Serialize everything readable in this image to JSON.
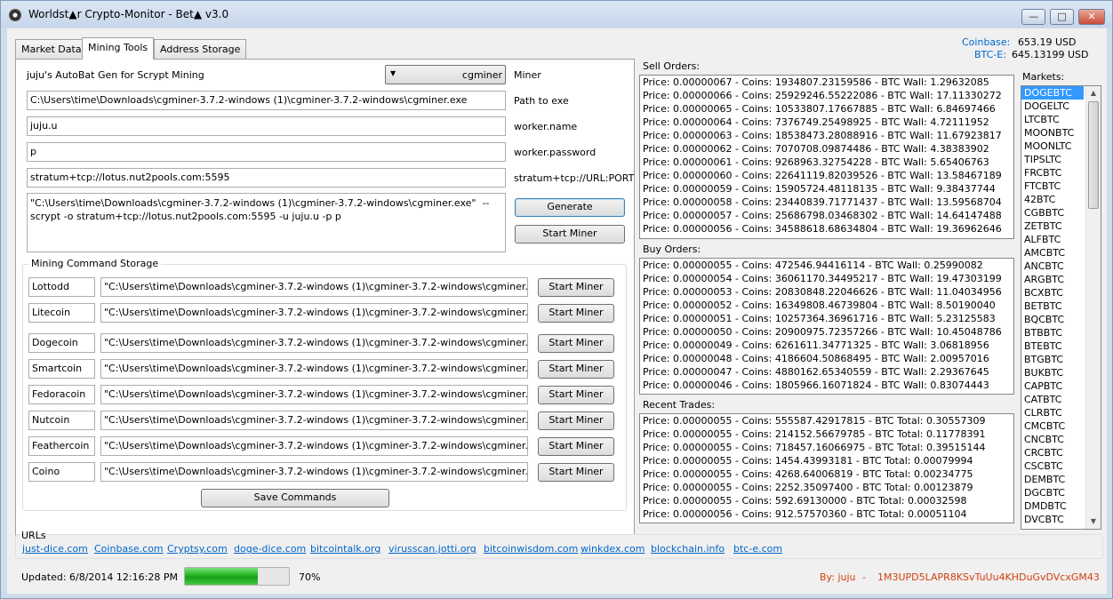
{
  "window": {
    "title": "Worldst▲r Crypto-Monitor - Bet▲ v3.0"
  },
  "tabs": [
    {
      "label": "Market Data"
    },
    {
      "label": "Mining Tools",
      "active": true
    },
    {
      "label": "Address Storage"
    }
  ],
  "autobat": {
    "heading": "juju's AutoBat Gen for Scrypt Mining",
    "miner_select": "cgminer",
    "miner_label": "Miner",
    "path_value": "C:\\Users\\time\\Downloads\\cgminer-3.7.2-windows (1)\\cgminer-3.7.2-windows\\cgminer.exe",
    "path_label": "Path to exe",
    "worker_name_value": "juju.u",
    "worker_name_label": "worker.name",
    "worker_password_value": "p",
    "worker_password_label": "worker.password",
    "url_value": "stratum+tcp://lotus.nut2pools.com:5595",
    "url_label": "stratum+tcp://URL:PORT",
    "command_output": "\"C:\\Users\\time\\Downloads\\cgminer-3.7.2-windows (1)\\cgminer-3.7.2-windows\\cgminer.exe\"  --scrypt -o stratum+tcp://lotus.nut2pools.com:5595 -u juju.u -p p",
    "generate_label": "Generate",
    "start_miner_label": "Start Miner"
  },
  "storage": {
    "title": "Mining Command Storage",
    "rows": [
      {
        "name": "Lottodd",
        "command": "\"C:\\Users\\time\\Downloads\\cgminer-3.7.2-windows (1)\\cgminer-3.7.2-windows\\cgminer.exe\"",
        "button": "Start Miner"
      },
      {
        "name": "Litecoin",
        "command": "\"C:\\Users\\time\\Downloads\\cgminer-3.7.2-windows (1)\\cgminer-3.7.2-windows\\cgminer.exe\"",
        "button": "Start Miner"
      },
      {
        "name": "Dogecoin",
        "command": "\"C:\\Users\\time\\Downloads\\cgminer-3.7.2-windows (1)\\cgminer-3.7.2-windows\\cgminer.exe\"",
        "button": "Start Miner"
      },
      {
        "name": "Smartcoin",
        "command": "\"C:\\Users\\time\\Downloads\\cgminer-3.7.2-windows (1)\\cgminer-3.7.2-windows\\cgminer.exe\"",
        "button": "Start Miner"
      },
      {
        "name": "Fedoracoin",
        "command": "\"C:\\Users\\time\\Downloads\\cgminer-3.7.2-windows (1)\\cgminer-3.7.2-windows\\cgminer.exe\" -",
        "button": "Start Miner"
      },
      {
        "name": "Nutcoin",
        "command": "\"C:\\Users\\time\\Downloads\\cgminer-3.7.2-windows (1)\\cgminer-3.7.2-windows\\cgminer.exe\"",
        "button": "Start Miner"
      },
      {
        "name": "Feathercoin",
        "command": "\"C:\\Users\\time\\Downloads\\cgminer-3.7.2-windows (1)\\cgminer-3.7.2-windows\\cgminer.exe\"",
        "button": "Start Miner"
      },
      {
        "name": "Coino",
        "command": "\"C:\\Users\\time\\Downloads\\cgminer-3.7.2-windows (1)\\cgminer-3.7.2-windows\\cgminer.exe\"",
        "button": "Start Miner"
      }
    ],
    "save_label": "Save Commands"
  },
  "prices": {
    "coinbase_label": "Coinbase:",
    "coinbase_value": "653.19 USD",
    "btce_label": "BTC-E:",
    "btce_value": "645.13199 USD",
    "accent_color": "#0066cc"
  },
  "sell_orders": {
    "title": "Sell Orders:",
    "rows": [
      "Price: 0.00000067 - Coins: 1934807.23159586 - BTC Wall: 1.29632085",
      "Price: 0.00000066 - Coins: 25929246.55222086 - BTC Wall: 17.11330272",
      "Price: 0.00000065 - Coins: 10533807.17667885 - BTC Wall: 6.84697466",
      "Price: 0.00000064 - Coins: 7376749.25498925 - BTC Wall: 4.72111952",
      "Price: 0.00000063 - Coins: 18538473.28088916 - BTC Wall: 11.67923817",
      "Price: 0.00000062 - Coins: 7070708.09874486 - BTC Wall: 4.38383902",
      "Price: 0.00000061 - Coins: 9268963.32754228 - BTC Wall: 5.65406763",
      "Price: 0.00000060 - Coins: 22641119.82039526 - BTC Wall: 13.58467189",
      "Price: 0.00000059 - Coins: 15905724.48118135 - BTC Wall: 9.38437744",
      "Price: 0.00000058 - Coins: 23440839.71771437 - BTC Wall: 13.59568704",
      "Price: 0.00000057 - Coins: 25686798.03468302 - BTC Wall: 14.64147488",
      "Price: 0.00000056 - Coins: 34588618.68634804 - BTC Wall: 19.36962646"
    ]
  },
  "buy_orders": {
    "title": "Buy Orders:",
    "rows": [
      "Price: 0.00000055 - Coins: 472546.94416114 - BTC Wall: 0.25990082",
      "Price: 0.00000054 - Coins: 36061170.34495217 - BTC Wall: 19.47303199",
      "Price: 0.00000053 - Coins: 20830848.22046626 - BTC Wall: 11.04034956",
      "Price: 0.00000052 - Coins: 16349808.46739804 - BTC Wall: 8.50190040",
      "Price: 0.00000051 - Coins: 10257364.36961716 - BTC Wall: 5.23125583",
      "Price: 0.00000050 - Coins: 20900975.72357266 - BTC Wall: 10.45048786",
      "Price: 0.00000049 - Coins: 6261611.34771325 - BTC Wall: 3.06818956",
      "Price: 0.00000048 - Coins: 4186604.50868495 - BTC Wall: 2.00957016",
      "Price: 0.00000047 - Coins: 4880162.65340559 - BTC Wall: 2.29367645",
      "Price: 0.00000046 - Coins: 1805966.16071824 - BTC Wall: 0.83074443"
    ]
  },
  "recent_trades": {
    "title": "Recent Trades:",
    "rows": [
      "Price: 0.00000055 - Coins: 555587.42917815 - BTC Total: 0.30557309",
      "Price: 0.00000055 - Coins: 214152.56679785 - BTC Total: 0.11778391",
      "Price: 0.00000055 - Coins: 718457.16066975 - BTC Total: 0.39515144",
      "Price: 0.00000055 - Coins: 1454.43993181 - BTC Total: 0.00079994",
      "Price: 0.00000055 - Coins: 4268.64006819 - BTC Total: 0.00234775",
      "Price: 0.00000055 - Coins: 2252.35097400 - BTC Total: 0.00123879",
      "Price: 0.00000055 - Coins: 592.69130000 - BTC Total: 0.00032598",
      "Price: 0.00000056 - Coins: 912.57570360 - BTC Total: 0.00051104"
    ]
  },
  "markets": {
    "title": "Markets:",
    "items": [
      "DOGEBTC",
      "DOGELTC",
      "LTCBTC",
      "MOONBTC",
      "MOONLTC",
      "TIPSLTC",
      "FRCBTC",
      "FTCBTC",
      "42BTC",
      "CGBBTC",
      "ZETBTC",
      "ALFBTC",
      "AMCBTC",
      "ANCBTC",
      "ARGBTC",
      "BCXBTC",
      "BETBTC",
      "BQCBTC",
      "BTBBTC",
      "BTEBTC",
      "BTGBTC",
      "BUKBTC",
      "CAPBTC",
      "CATBTC",
      "CLRBTC",
      "CMCBTC",
      "CNCBTC",
      "CRCBTC",
      "CSCBTC",
      "DEMBTC",
      "DGCBTC",
      "DMDBTC",
      "DVCBTC"
    ],
    "selected": "DOGEBTC"
  },
  "urls": {
    "title": "URLs",
    "links": [
      "just-dice.com",
      "Coinbase.com",
      "Cryptsy.com",
      "doge-dice.com",
      "bitcointalk.org",
      "virusscan.jotti.org",
      "bitcoinwisdom.com",
      "winkdex.com",
      "blockchain.info",
      "btc-e.com"
    ]
  },
  "status": {
    "updated": "Updated: 6/8/2014 12:16:28 PM",
    "progress_percent": 70,
    "progress_text": "70%",
    "credit_by": "By: juju",
    "credit_sep": "-",
    "credit_address": "1M3UPD5LAPR8KSvTuUu4KHDuGvDVcxGM43",
    "credit_color": "#d04010"
  }
}
